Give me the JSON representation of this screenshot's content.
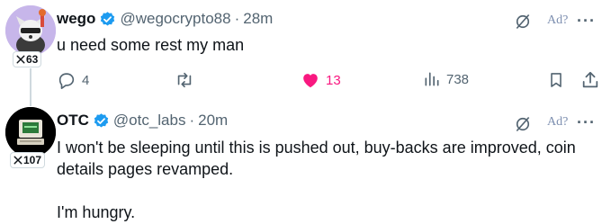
{
  "tweets": [
    {
      "name": "wego",
      "handle": "@wegocrypto88",
      "separator": "·",
      "time": "28m",
      "text": "u need some rest my man",
      "badge": "63",
      "ad_label": "Ad?",
      "more": "···",
      "actions": {
        "replies": "4",
        "retweets": "",
        "likes": "13",
        "views": "738"
      }
    },
    {
      "name": "OTC",
      "handle": "@otc_labs",
      "separator": "·",
      "time": "20m",
      "text_lines": [
        "I won't be sleeping until this is pushed out, buy-backs are improved, coin",
        "details pages revamped.",
        "I'm hungry."
      ],
      "badge": "107",
      "ad_label": "Ad?",
      "more": "···"
    }
  ],
  "colors": {
    "verified": "#1d9bf0",
    "like_active": "#f91880",
    "muted": "#536471",
    "thread_line": "#cfd9de"
  },
  "icons": [
    "verified-icon",
    "reply-icon",
    "retweet-icon",
    "heart-icon",
    "views-icon",
    "bookmark-icon",
    "share-icon",
    "mute-icon",
    "x-logo-icon"
  ]
}
